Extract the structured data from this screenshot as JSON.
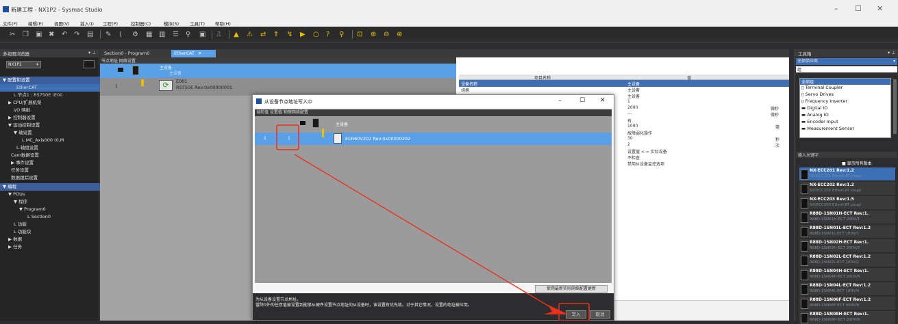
{
  "window": {
    "title": "新建工程 - NX1P2 - Sysmac Studio",
    "min": "–",
    "max": "☐",
    "close": "✕"
  },
  "menu": [
    "文件(F)",
    "编辑(E)",
    "视图(V)",
    "插入(I)",
    "工程(P)",
    "控制器(C)",
    "模拟(S)",
    "工具(T)",
    "帮助(H)"
  ],
  "left_panel": {
    "title": "多视图浏览器",
    "pin": "▾ ⊥",
    "controller": "NX1P2",
    "dropdown": "▾",
    "section_config": "▼ 配置和设置",
    "items": [
      "EtherCAT",
      "L 节点1 : RS750E (E00",
      "▶ CPU/扩展机架",
      "I/O 映射",
      "▶ 控制器设置",
      "▼ 运动控制设置",
      "▼ 轴设置",
      "L MC_Axis000 (0,M",
      "L 轴组设置",
      "Cam数据设置",
      "▶ 事件设置",
      "任务设置",
      "数据跟踪设置"
    ],
    "section_program": "▼ 编程",
    "prog_items": [
      "▼ POUs",
      "▼ 程序",
      "▼ Program0",
      "L Section0",
      "L 功能",
      "L 功能块",
      "▶ 数据",
      "▶ 任务"
    ]
  },
  "tabs": [
    {
      "label": "Section0 - Program0"
    },
    {
      "label": "EtherCAT",
      "close": "✕"
    }
  ],
  "network": {
    "header": "节点地址 网络设置",
    "master_label": "主设备",
    "master_sub": "主设备",
    "node_num": "1",
    "node_name": "E001",
    "node_model": "RS750E Rev:0x00000001"
  },
  "properties": {
    "col_name": "项目名称",
    "col_value": "值",
    "rows": [
      {
        "name": "设备名称",
        "value": "主设备",
        "unit": ""
      },
      {
        "name": "切换",
        "value": "主设备",
        "unit": ""
      },
      {
        "name": "",
        "value": "主设备",
        "unit": ""
      },
      {
        "name": "",
        "value": "1",
        "unit": ""
      },
      {
        "name": "",
        "value": "2000",
        "unit": "微秒"
      },
      {
        "name": "",
        "value": "---",
        "unit": "微秒"
      },
      {
        "name": "",
        "value": "有",
        "unit": ""
      },
      {
        "name": "",
        "value": "1000",
        "unit": "毫"
      },
      {
        "name": "",
        "value": "故障弱化操作",
        "unit": ""
      },
      {
        "name": "",
        "value": "30",
        "unit": "秒"
      },
      {
        "name": "",
        "value": "2",
        "unit": "次"
      },
      {
        "name": "",
        "value": "设置值 < = 实际设备",
        "unit": ""
      },
      {
        "name": "",
        "value": "不检查",
        "unit": ""
      },
      {
        "name": "",
        "value": "禁用从设备监控选项",
        "unit": ""
      }
    ]
  },
  "toolbox": {
    "title": "工具箱",
    "pin": "▾ ⊥",
    "vendor": "全部供应商",
    "group_label": "组",
    "groups": [
      "全部组",
      "Terminal Coupler",
      "Servo Drives",
      "Frequency Inverter",
      "Digital IO",
      "Analog IO",
      "Encoder Input",
      "Measurement Sensor"
    ],
    "keyword_placeholder": "输入关键字",
    "show_all": "显示所有版本",
    "devices": [
      {
        "name": "NX-ECC201 Rev:1.2",
        "sub": "NX-ECC201 EtherCAT coupl"
      },
      {
        "name": "NX-ECC202 Rev:1.2",
        "sub": "NX-ECC202 EtherCAT coupl"
      },
      {
        "name": "NX-ECC203 Rev:1.5",
        "sub": "NX-ECC203 EtherCAT coupl"
      },
      {
        "name": "R88D-1SN01H-ECT Rev:1.",
        "sub": "R88D-1SN01H-ECT 200V/1"
      },
      {
        "name": "R88D-1SN01L-ECT Rev:1.2",
        "sub": "R88D-1SN01L-ECT 100V/1"
      },
      {
        "name": "R88D-1SN02H-ECT Rev:1.",
        "sub": "R88D-1SN02H-ECT 200V/2"
      },
      {
        "name": "R88D-1SN02L-ECT Rev:1.2",
        "sub": "R88D-1SN02L-ECT 100V/2"
      },
      {
        "name": "R88D-1SN04H-ECT Rev:1.",
        "sub": "R88D-1SN04H-ECT 200V/4"
      },
      {
        "name": "R88D-1SN04L-ECT Rev:1.2",
        "sub": "R88D-1SN04L-ECT 100V/4"
      },
      {
        "name": "R88D-1SN06F-ECT Rev:1.2",
        "sub": "R88D-1SN06F-ECT 400V/6"
      },
      {
        "name": "R88D-1SN08H-ECT Rev:1.",
        "sub": "R88D-1SN08H-ECT 200V/8"
      }
    ]
  },
  "dialog": {
    "title": "从设备节点地址写入中",
    "min": "–",
    "max": "☐",
    "close": "✕",
    "header": "当前值  设置值  物理网络配置",
    "master": "主设备",
    "current": "1",
    "setting": "1",
    "device": "ECR60V202 Rev:0x00000202",
    "update_button": "使用最新实际网络配置更新",
    "desc1": "为从设备设置节点地址。",
    "desc2": "當除0外的任意值被设置到能够从硬件设置节点地址的从设备时，该设置有优先级。对于其它情况，设置的地址被应用。",
    "write_button": "写入",
    "cancel_button": "取消"
  },
  "colors": {
    "annotation": "#e8321e",
    "selection": "#3d6fb4",
    "dialog_row": "#5aa0e6"
  }
}
